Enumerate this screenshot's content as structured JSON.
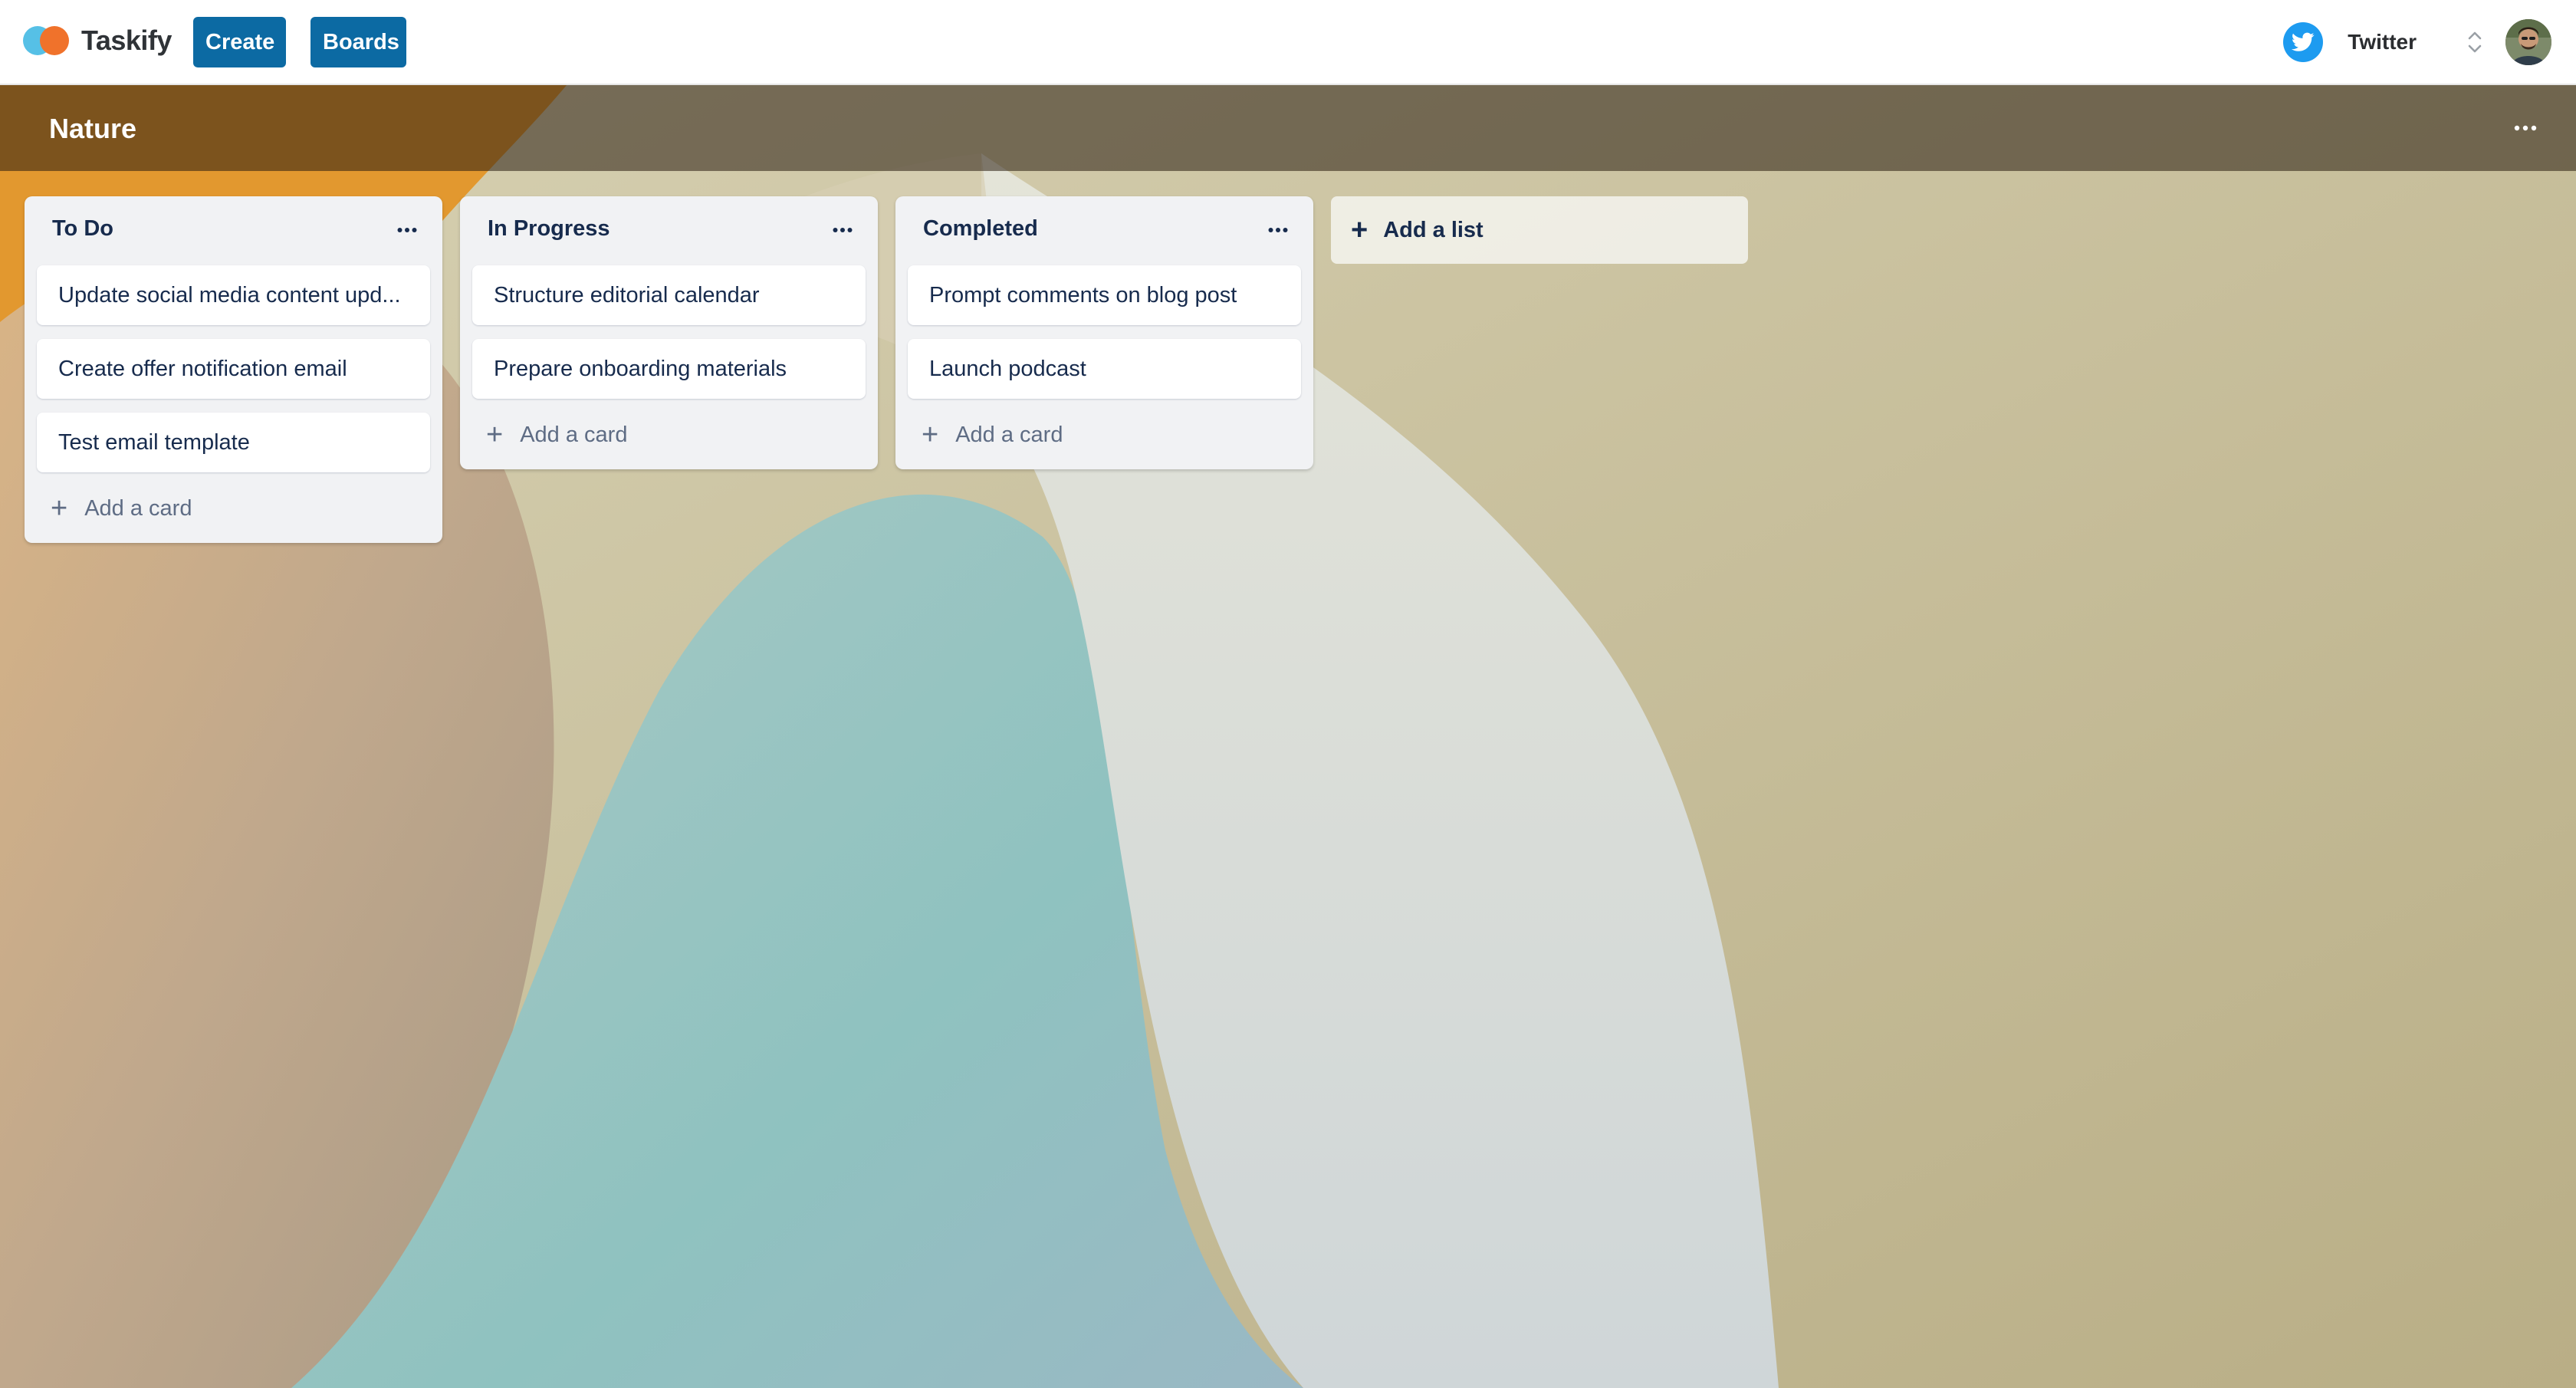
{
  "app": {
    "name": "Taskify",
    "create_label": "Create",
    "boards_label": "Boards",
    "workspace_name": "Twitter",
    "workspace_icon": "twitter-icon",
    "brand_color": "#0c6aa3"
  },
  "board": {
    "title": "Nature",
    "menu_label": "···"
  },
  "lists": [
    {
      "title": "To Do",
      "cards": [
        "Update social media content upd...",
        "Create offer notification email",
        "Test email template"
      ],
      "add_card_label": "Add a card"
    },
    {
      "title": "In Progress",
      "cards": [
        "Structure editorial calendar",
        "Prepare onboarding materials"
      ],
      "add_card_label": "Add a card"
    },
    {
      "title": "Completed",
      "cards": [
        "Prompt comments on blog post",
        "Launch podcast"
      ],
      "add_card_label": "Add a card"
    }
  ],
  "add_list_label": "Add a list",
  "icons": {
    "plus": "+",
    "more": "···"
  }
}
